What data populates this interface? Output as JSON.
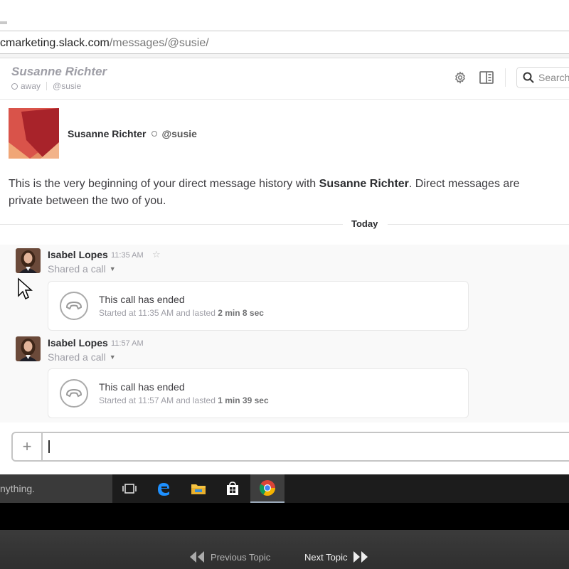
{
  "browser": {
    "url_host": "cmarketing.slack.com",
    "url_path": "/messages/@susie/"
  },
  "channel_header": {
    "name": "Susanne Richter",
    "status": "away",
    "handle": "@susie",
    "search_placeholder": "Search"
  },
  "intro": {
    "name": "Susanne Richter",
    "handle": "@susie",
    "text_before": "This is the very beginning of your direct message history with ",
    "text_name": "Susanne Richter",
    "text_after": ". Direct messages are private between the two of you."
  },
  "day_divider": "Today",
  "messages": [
    {
      "author": "Isabel Lopes",
      "time": "11:35 AM",
      "shared": "Shared a call",
      "call_title": "This call has ended",
      "call_detail_prefix": "Started at 11:35 AM and lasted ",
      "call_duration": "2 min 8 sec"
    },
    {
      "author": "Isabel Lopes",
      "time": "11:57 AM",
      "shared": "Shared a call",
      "call_title": "This call has ended",
      "call_detail_prefix": "Started at 11:57 AM and lasted ",
      "call_duration": "1 min 39 sec"
    }
  ],
  "composer": {
    "plus_label": "+"
  },
  "taskbar": {
    "search_text": "nything."
  },
  "player": {
    "previous_label": "Previous Topic",
    "next_label": "Next Topic"
  },
  "colors": {
    "accent_red": "#c0392b",
    "avatar_orange": "#e8835a"
  }
}
